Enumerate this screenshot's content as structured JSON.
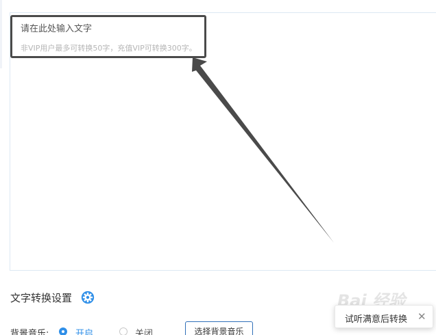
{
  "textarea": {
    "placeholder_main": "请在此处输入文字",
    "placeholder_sub": "非VIP用户最多可转换50字，充值VIP可转换300字。"
  },
  "settings": {
    "title": "文字转换设置",
    "gear_icon": "gear-icon"
  },
  "bgm": {
    "label": "背景音乐:",
    "option_on": "开启",
    "option_off": "关闭",
    "selected": "开启",
    "select_button": "选择背景音乐"
  },
  "toast": {
    "text": "试听满意后转换",
    "close_icon": "close-icon"
  },
  "watermark": {
    "text": "Bai 经验"
  },
  "colors": {
    "accent": "#2f8fe8",
    "annotation": "#4a4a4a"
  }
}
